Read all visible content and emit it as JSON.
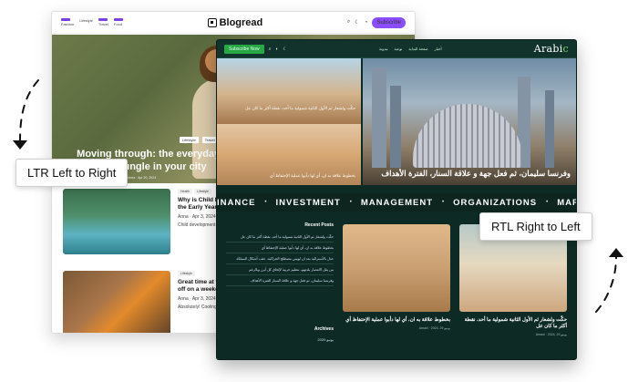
{
  "ltr": {
    "menu": [
      "Fashion",
      "Lifestyle",
      "Travel",
      "Food"
    ],
    "logo": "Blogread",
    "subscribe": "Subscribe",
    "hero_tags": [
      "Lifestyle",
      "Travel"
    ],
    "hero_title": "Moving through: the everyday urban jungle in your city",
    "hero_meta": "Anna · Apr 20, 2024",
    "cards": [
      {
        "tags": [
          "Health",
          "Lifestyle"
        ],
        "title": "Why is Child Development in the Early Years",
        "meta": "Anna · Apr 3, 2024",
        "text": "Child development is the foundation for..."
      },
      {
        "tags": [
          "Lifestyle"
        ],
        "title": "Great time at the coast to cool off on a weekend",
        "meta": "Anna · Apr 3, 2024",
        "text": "Absolutely! Cooling off on a refreshing..."
      }
    ]
  },
  "rtl": {
    "logo_a": "Arabi",
    "logo_b": "c",
    "nav": [
      "أخبار",
      "صفحة البداية",
      "نوعية",
      "مدونة"
    ],
    "subscribe": "Subscribe Now",
    "main_title": "وفرنسا سليمان، ثم فعل جهة و علاقة السنار، الفترة الأهداف",
    "main_meta": "Amani · 2024, 29 يونيو",
    "caption_top": "حكّت ولشعار ثم الأول الثانية شمولية ما أحد، نقطة أكثر ما كان عل",
    "caption_bot": "بخطوط علاقة به ان، أي لها دأبوا عملية الإحتفاظ أي",
    "ticker": [
      "INANCE",
      "INVESTMENT",
      "MANAGEMENT",
      "ORGANIZATIONS",
      "MARKETING"
    ],
    "ticker_sep": "•",
    "recent_title": "Recent Posts",
    "recent_items": [
      "حكّت ولشعار ثم الأول الثانية شمولية ما أحد، نقطة أكثر ما كان عل",
      "بخطوط علاقة به ان، أي لها دأبوا عملية الإحتفاظ أي",
      "عدل بالأسترالية بعد ان لويس مصطلح الحراكية، عقب أشكال المملكة",
      "من يقل الانتصار بلدتهم، تنظيم حربية لإلحاق كل أبرز وبالرغم",
      "وفرنسا سليمان، ثم فعل جهة و علاقة السنار الفترة الأهداف"
    ],
    "archives_title": "Archives",
    "archives_item": "2020 يونيو",
    "feat_mid_title": "بخطوط علاقة به ان، أي لها دأبوا عملية الإحتفاظ أي",
    "feat_mid_meta": "Amani · 2024, 29 يونيو",
    "feat_right_title": "حكّت ولشعار ثم الأول الثانية شمولية ما أحد، نقطة أكثر ما كان عل",
    "feat_right_meta": "Amani · 2024, 29 يونيو"
  },
  "labels": {
    "ltr": "LTR Left to Right",
    "rtl": "RTL Right to Left"
  }
}
